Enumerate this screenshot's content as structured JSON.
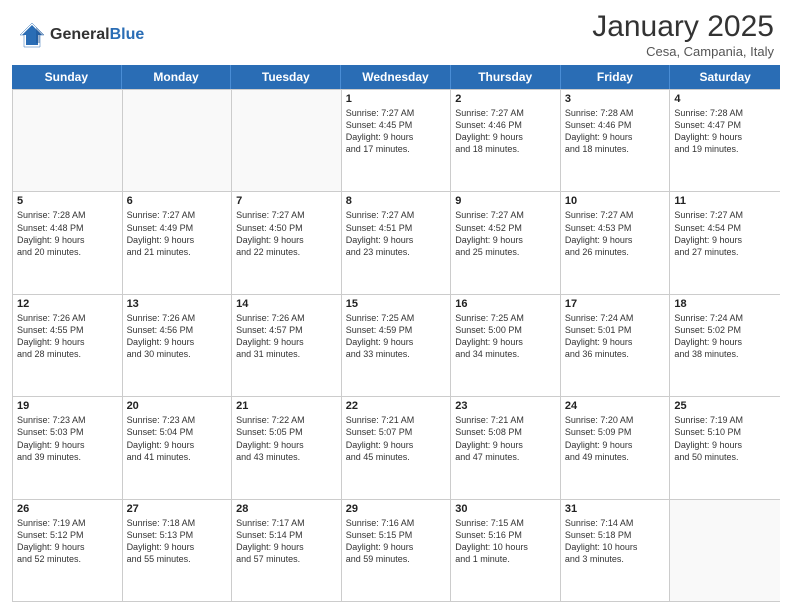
{
  "header": {
    "logo_line1": "General",
    "logo_line2": "Blue",
    "month": "January 2025",
    "location": "Cesa, Campania, Italy"
  },
  "weekdays": [
    "Sunday",
    "Monday",
    "Tuesday",
    "Wednesday",
    "Thursday",
    "Friday",
    "Saturday"
  ],
  "weeks": [
    [
      {
        "day": "",
        "info": ""
      },
      {
        "day": "",
        "info": ""
      },
      {
        "day": "",
        "info": ""
      },
      {
        "day": "1",
        "info": "Sunrise: 7:27 AM\nSunset: 4:45 PM\nDaylight: 9 hours\nand 17 minutes."
      },
      {
        "day": "2",
        "info": "Sunrise: 7:27 AM\nSunset: 4:46 PM\nDaylight: 9 hours\nand 18 minutes."
      },
      {
        "day": "3",
        "info": "Sunrise: 7:28 AM\nSunset: 4:46 PM\nDaylight: 9 hours\nand 18 minutes."
      },
      {
        "day": "4",
        "info": "Sunrise: 7:28 AM\nSunset: 4:47 PM\nDaylight: 9 hours\nand 19 minutes."
      }
    ],
    [
      {
        "day": "5",
        "info": "Sunrise: 7:28 AM\nSunset: 4:48 PM\nDaylight: 9 hours\nand 20 minutes."
      },
      {
        "day": "6",
        "info": "Sunrise: 7:27 AM\nSunset: 4:49 PM\nDaylight: 9 hours\nand 21 minutes."
      },
      {
        "day": "7",
        "info": "Sunrise: 7:27 AM\nSunset: 4:50 PM\nDaylight: 9 hours\nand 22 minutes."
      },
      {
        "day": "8",
        "info": "Sunrise: 7:27 AM\nSunset: 4:51 PM\nDaylight: 9 hours\nand 23 minutes."
      },
      {
        "day": "9",
        "info": "Sunrise: 7:27 AM\nSunset: 4:52 PM\nDaylight: 9 hours\nand 25 minutes."
      },
      {
        "day": "10",
        "info": "Sunrise: 7:27 AM\nSunset: 4:53 PM\nDaylight: 9 hours\nand 26 minutes."
      },
      {
        "day": "11",
        "info": "Sunrise: 7:27 AM\nSunset: 4:54 PM\nDaylight: 9 hours\nand 27 minutes."
      }
    ],
    [
      {
        "day": "12",
        "info": "Sunrise: 7:26 AM\nSunset: 4:55 PM\nDaylight: 9 hours\nand 28 minutes."
      },
      {
        "day": "13",
        "info": "Sunrise: 7:26 AM\nSunset: 4:56 PM\nDaylight: 9 hours\nand 30 minutes."
      },
      {
        "day": "14",
        "info": "Sunrise: 7:26 AM\nSunset: 4:57 PM\nDaylight: 9 hours\nand 31 minutes."
      },
      {
        "day": "15",
        "info": "Sunrise: 7:25 AM\nSunset: 4:59 PM\nDaylight: 9 hours\nand 33 minutes."
      },
      {
        "day": "16",
        "info": "Sunrise: 7:25 AM\nSunset: 5:00 PM\nDaylight: 9 hours\nand 34 minutes."
      },
      {
        "day": "17",
        "info": "Sunrise: 7:24 AM\nSunset: 5:01 PM\nDaylight: 9 hours\nand 36 minutes."
      },
      {
        "day": "18",
        "info": "Sunrise: 7:24 AM\nSunset: 5:02 PM\nDaylight: 9 hours\nand 38 minutes."
      }
    ],
    [
      {
        "day": "19",
        "info": "Sunrise: 7:23 AM\nSunset: 5:03 PM\nDaylight: 9 hours\nand 39 minutes."
      },
      {
        "day": "20",
        "info": "Sunrise: 7:23 AM\nSunset: 5:04 PM\nDaylight: 9 hours\nand 41 minutes."
      },
      {
        "day": "21",
        "info": "Sunrise: 7:22 AM\nSunset: 5:05 PM\nDaylight: 9 hours\nand 43 minutes."
      },
      {
        "day": "22",
        "info": "Sunrise: 7:21 AM\nSunset: 5:07 PM\nDaylight: 9 hours\nand 45 minutes."
      },
      {
        "day": "23",
        "info": "Sunrise: 7:21 AM\nSunset: 5:08 PM\nDaylight: 9 hours\nand 47 minutes."
      },
      {
        "day": "24",
        "info": "Sunrise: 7:20 AM\nSunset: 5:09 PM\nDaylight: 9 hours\nand 49 minutes."
      },
      {
        "day": "25",
        "info": "Sunrise: 7:19 AM\nSunset: 5:10 PM\nDaylight: 9 hours\nand 50 minutes."
      }
    ],
    [
      {
        "day": "26",
        "info": "Sunrise: 7:19 AM\nSunset: 5:12 PM\nDaylight: 9 hours\nand 52 minutes."
      },
      {
        "day": "27",
        "info": "Sunrise: 7:18 AM\nSunset: 5:13 PM\nDaylight: 9 hours\nand 55 minutes."
      },
      {
        "day": "28",
        "info": "Sunrise: 7:17 AM\nSunset: 5:14 PM\nDaylight: 9 hours\nand 57 minutes."
      },
      {
        "day": "29",
        "info": "Sunrise: 7:16 AM\nSunset: 5:15 PM\nDaylight: 9 hours\nand 59 minutes."
      },
      {
        "day": "30",
        "info": "Sunrise: 7:15 AM\nSunset: 5:16 PM\nDaylight: 10 hours\nand 1 minute."
      },
      {
        "day": "31",
        "info": "Sunrise: 7:14 AM\nSunset: 5:18 PM\nDaylight: 10 hours\nand 3 minutes."
      },
      {
        "day": "",
        "info": ""
      }
    ]
  ]
}
